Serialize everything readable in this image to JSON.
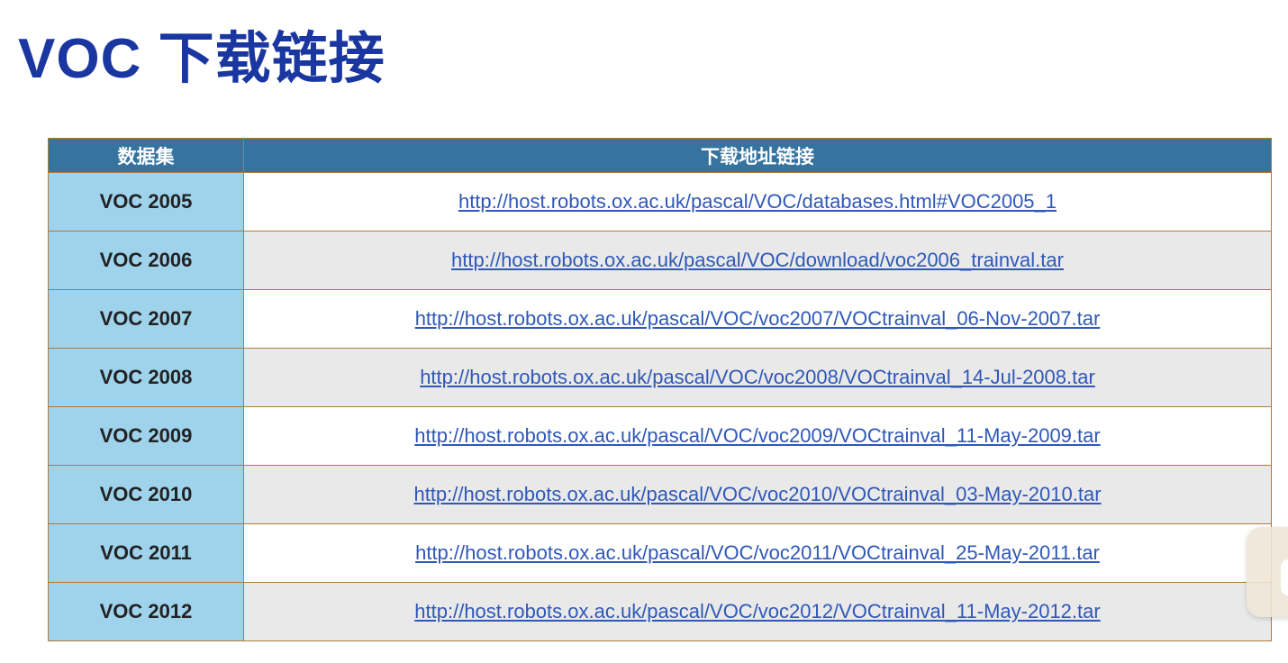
{
  "title": "VOC 下载链接",
  "table": {
    "headers": [
      "数据集",
      "下载地址链接"
    ],
    "rows": [
      {
        "name": "VOC 2005",
        "url": "http://host.robots.ox.ac.uk/pascal/VOC/databases.html#VOC2005_1"
      },
      {
        "name": "VOC 2006",
        "url": "http://host.robots.ox.ac.uk/pascal/VOC/download/voc2006_trainval.tar"
      },
      {
        "name": "VOC 2007",
        "url": "http://host.robots.ox.ac.uk/pascal/VOC/voc2007/VOCtrainval_06-Nov-2007.tar"
      },
      {
        "name": "VOC 2008",
        "url": "http://host.robots.ox.ac.uk/pascal/VOC/voc2008/VOCtrainval_14-Jul-2008.tar"
      },
      {
        "name": "VOC 2009",
        "url": "http://host.robots.ox.ac.uk/pascal/VOC/voc2009/VOCtrainval_11-May-2009.tar"
      },
      {
        "name": "VOC 2010",
        "url": "http://host.robots.ox.ac.uk/pascal/VOC/voc2010/VOCtrainval_03-May-2010.tar"
      },
      {
        "name": "VOC 2011",
        "url": "http://host.robots.ox.ac.uk/pascal/VOC/voc2011/VOCtrainval_25-May-2011.tar"
      },
      {
        "name": "VOC 2012",
        "url": "http://host.robots.ox.ac.uk/pascal/VOC/voc2012/VOCtrainval_11-May-2012.tar"
      }
    ]
  }
}
